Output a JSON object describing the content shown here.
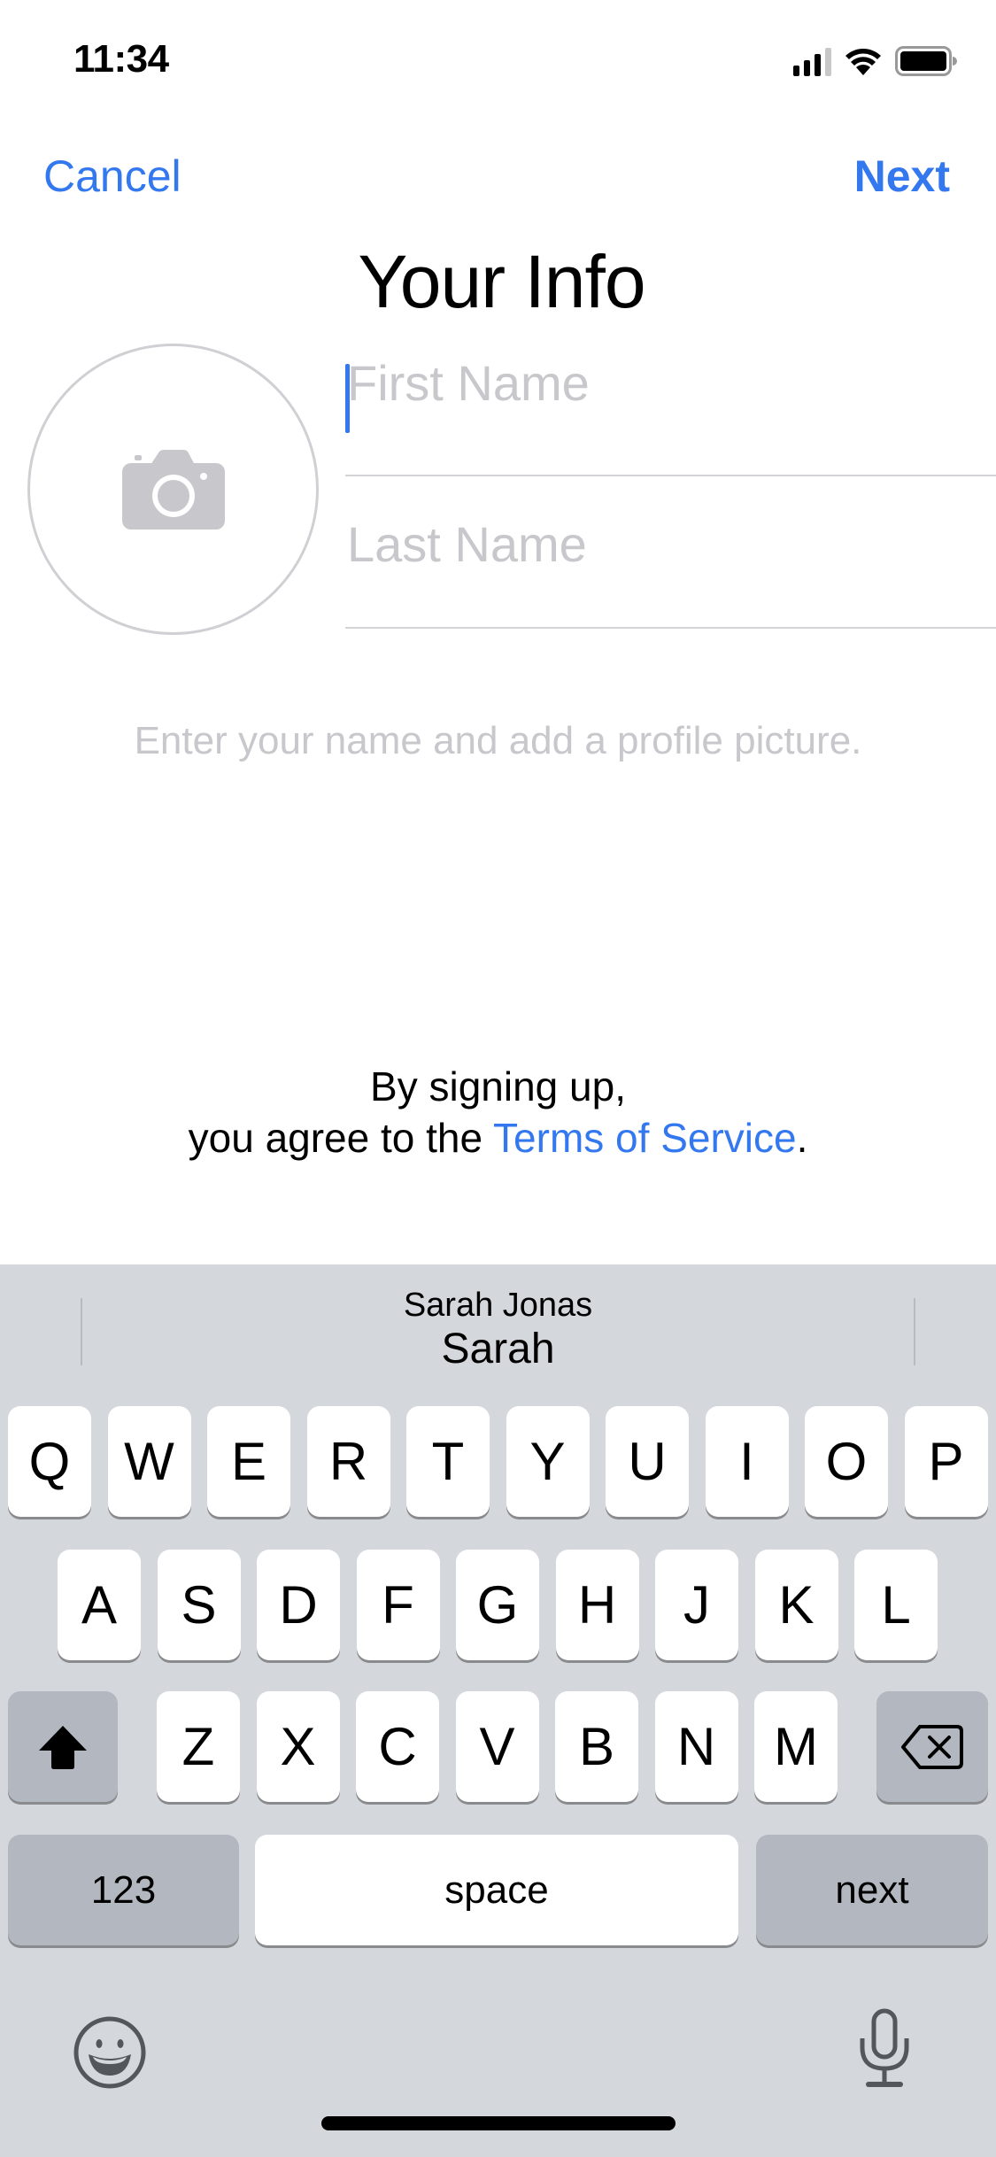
{
  "status_bar": {
    "time": "11:34",
    "signal_bars_active": 3,
    "signal_bars_total": 4,
    "icons": [
      "cellular-signal-icon",
      "wifi-icon",
      "battery-icon"
    ]
  },
  "nav": {
    "cancel_label": "Cancel",
    "next_label": "Next",
    "title": "Your Info"
  },
  "form": {
    "avatar_icon": "camera-icon",
    "first_name": {
      "value": "",
      "placeholder": "First Name"
    },
    "last_name": {
      "value": "",
      "placeholder": "Last Name"
    },
    "hint": "Enter your name and add a profile picture."
  },
  "terms": {
    "line1": "By signing up,",
    "line2_prefix": "you agree to the ",
    "link_label": "Terms of Service",
    "line2_suffix": "."
  },
  "keyboard": {
    "predictive": {
      "suggestion_secondary": "Sarah Jonas",
      "suggestion_primary": "Sarah"
    },
    "rows": [
      [
        "Q",
        "W",
        "E",
        "R",
        "T",
        "Y",
        "U",
        "I",
        "O",
        "P"
      ],
      [
        "A",
        "S",
        "D",
        "F",
        "G",
        "H",
        "J",
        "K",
        "L"
      ],
      [
        "Z",
        "X",
        "C",
        "V",
        "B",
        "N",
        "M"
      ]
    ],
    "shift_icon": "shift-arrow-icon",
    "delete_icon": "backspace-icon",
    "numbers_label": "123",
    "space_label": "space",
    "return_label": "next",
    "emoji_icon": "emoji-icon",
    "dictation_icon": "microphone-icon"
  },
  "colors": {
    "accent": "#3478f0",
    "placeholder": "#c7c7cc",
    "keyboard_bg": "#d4d7dc",
    "key_dark": "#b3b7c0"
  }
}
